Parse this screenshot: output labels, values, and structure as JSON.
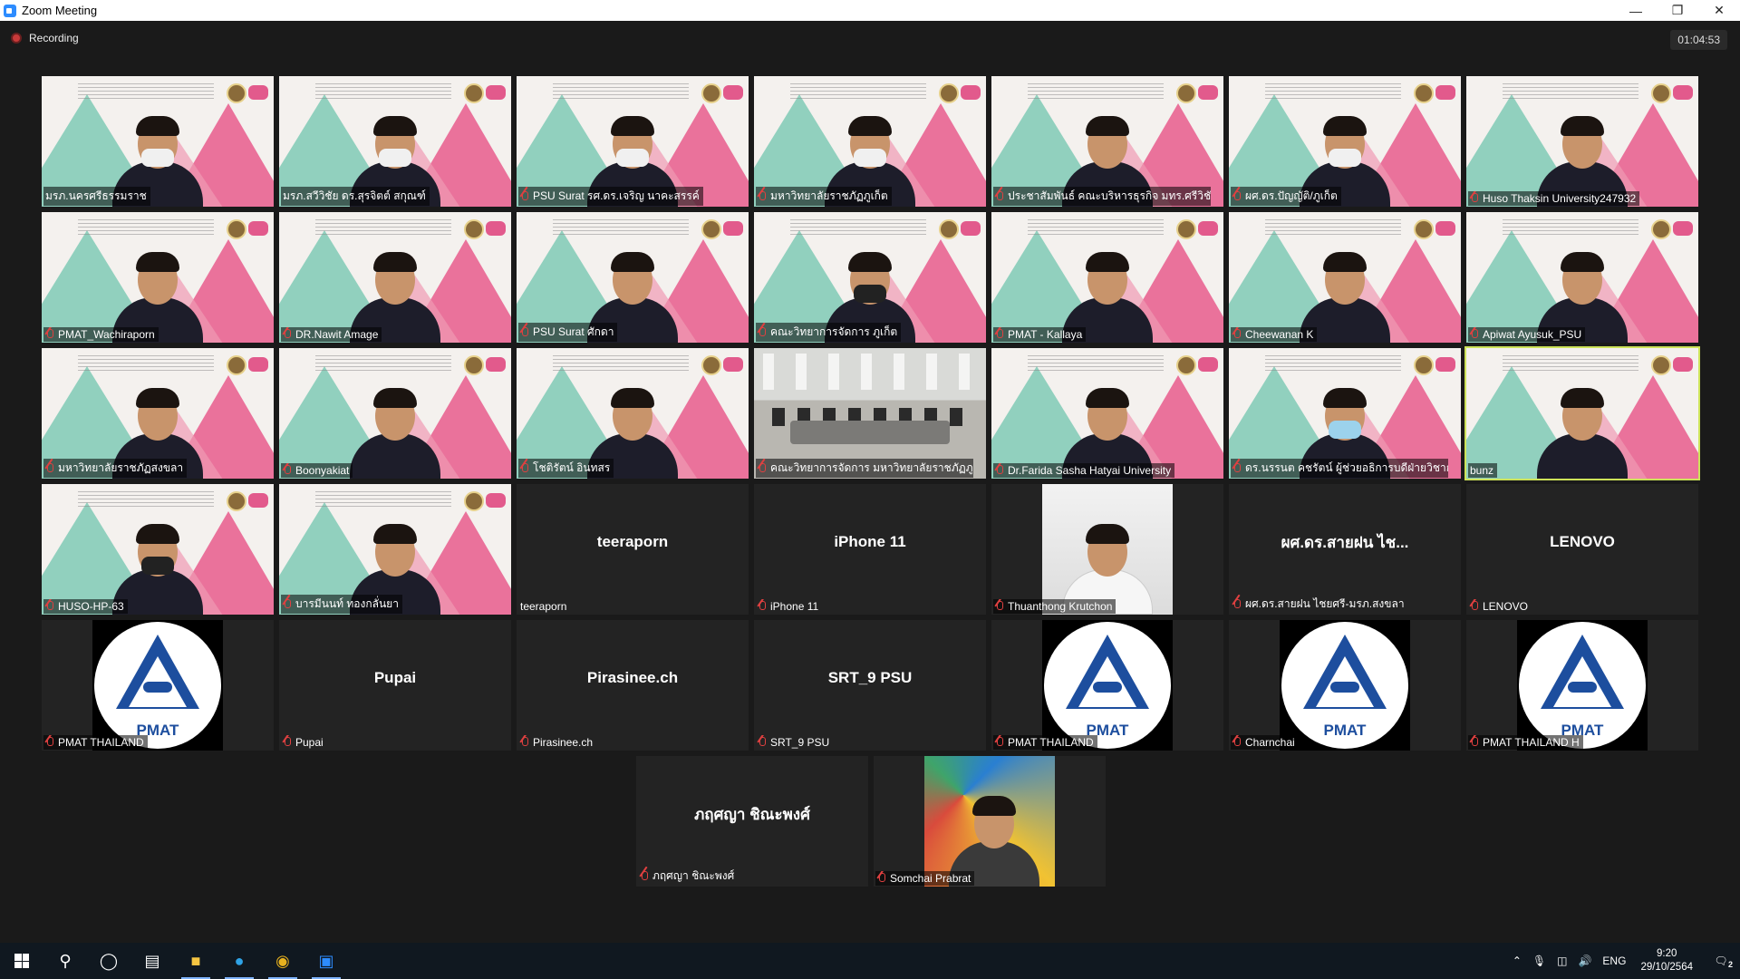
{
  "window": {
    "title": "Zoom Meeting",
    "minimize": "—",
    "restore": "❐",
    "close": "✕"
  },
  "meeting": {
    "recording_label": "Recording",
    "elapsed": "01:04:53"
  },
  "tiles": [
    {
      "name": "มรภ.นครศรีธรรมราช",
      "kind": "slide",
      "muted": false,
      "mask": "light"
    },
    {
      "name": "มรภ.สวีวิชัย ดร.สุรจิตต์ สกุณฑ์",
      "kind": "slide",
      "muted": false,
      "mask": "light"
    },
    {
      "name": "PSU Surat รศ.ดร.เจริญ นาคะสรรค์",
      "kind": "slide",
      "muted": true,
      "mask": "light"
    },
    {
      "name": "มหาวิทยาลัยราชภัฏภูเก็ต",
      "kind": "slide",
      "muted": true,
      "mask": "light"
    },
    {
      "name": "ประชาสัมพันธ์ คณะบริหารธุรกิจ มทร.ศรีวิชัย",
      "kind": "slide",
      "muted": true,
      "mask": "none"
    },
    {
      "name": "ผศ.ดร.ปัญญัติ/ภูเก็ต",
      "kind": "slide",
      "muted": true,
      "mask": "light"
    },
    {
      "name": "Huso Thaksin University247932",
      "kind": "slide",
      "muted": true,
      "mask": "none"
    },
    {
      "name": "PMAT_Wachiraporn",
      "kind": "slide",
      "muted": true,
      "mask": "none"
    },
    {
      "name": "DR.Nawit Amage",
      "kind": "slide",
      "muted": true,
      "mask": "none"
    },
    {
      "name": "PSU Surat ศักดา",
      "kind": "slide",
      "muted": true,
      "mask": "none"
    },
    {
      "name": "คณะวิทยาการจัดการ ภูเก็ต",
      "kind": "slide",
      "muted": true,
      "mask": "dark"
    },
    {
      "name": "PMAT - Kallaya",
      "kind": "slide",
      "muted": true,
      "mask": "none"
    },
    {
      "name": "Cheewanan K",
      "kind": "slide",
      "muted": true,
      "mask": "none"
    },
    {
      "name": "Apiwat Ayusuk_PSU",
      "kind": "slide",
      "muted": true,
      "mask": "none"
    },
    {
      "name": "มหาวิทยาลัยราชภัฏสงขลา",
      "kind": "slide",
      "muted": true,
      "mask": "none"
    },
    {
      "name": "Boonyakiat",
      "kind": "slide",
      "muted": true,
      "mask": "none"
    },
    {
      "name": "โชติรัตน์ อินทสร",
      "kind": "slide",
      "muted": true,
      "mask": "none"
    },
    {
      "name": "คณะวิทยาการจัดการ มหาวิทยาลัยราชภัฏภูเก็ต",
      "kind": "room",
      "muted": true,
      "mask": "none"
    },
    {
      "name": "Dr.Farida  Sasha  Hatyai University",
      "kind": "slide",
      "muted": true,
      "mask": "none"
    },
    {
      "name": "ดร.นรรนต คชรัตน์ ผู้ช่วยอธิการบดีฝ่ายวิชาก...",
      "kind": "slide",
      "muted": true,
      "mask": "blue"
    },
    {
      "name": "bunz",
      "kind": "slide",
      "muted": false,
      "mask": "none",
      "active": true
    },
    {
      "name": "HUSO-HP-63",
      "kind": "slide",
      "muted": true,
      "mask": "dark"
    },
    {
      "name": "บารมีนนท์ ทองกลั่นยา",
      "kind": "slide",
      "muted": true,
      "mask": "none"
    },
    {
      "name": "teeraporn",
      "kind": "text",
      "display": "teeraporn",
      "muted": false
    },
    {
      "name": "iPhone 11",
      "kind": "text",
      "display": "iPhone 11",
      "muted": true
    },
    {
      "name": "Thuanthong Krutchon",
      "kind": "photo",
      "muted": true
    },
    {
      "name": "ผศ.ดร.สายฝน ไชยศรี-มรภ.สงขลา",
      "kind": "text",
      "display": "ผศ.ดร.สายฝน ไช...",
      "muted": true
    },
    {
      "name": "LENOVO",
      "kind": "text",
      "display": "LENOVO",
      "muted": true
    },
    {
      "name": "PMAT THAILAND",
      "kind": "logo",
      "muted": true
    },
    {
      "name": "Pupai",
      "kind": "text",
      "display": "Pupai",
      "muted": true
    },
    {
      "name": "Pirasinee.ch",
      "kind": "text",
      "display": "Pirasinee.ch",
      "muted": true
    },
    {
      "name": "SRT_9 PSU",
      "kind": "text",
      "display": "SRT_9 PSU",
      "muted": true
    },
    {
      "name": "PMAT THAILAND",
      "kind": "logo",
      "muted": true
    },
    {
      "name": "Charnchai",
      "kind": "logo",
      "muted": true
    },
    {
      "name": "PMAT THAILAND H",
      "kind": "logo",
      "muted": true
    },
    {
      "name": "ภฤศญา ชิณะพงศ์",
      "kind": "text",
      "display": "ภฤศญา ชิณะพงศ์",
      "muted": true
    },
    {
      "name": "Somchai Prabrat",
      "kind": "mosaic",
      "muted": true
    }
  ],
  "logo_text": "PMAT",
  "taskbar": {
    "lang": "ENG",
    "time": "9:20",
    "date": "29/10/2564",
    "notifications": "2"
  }
}
